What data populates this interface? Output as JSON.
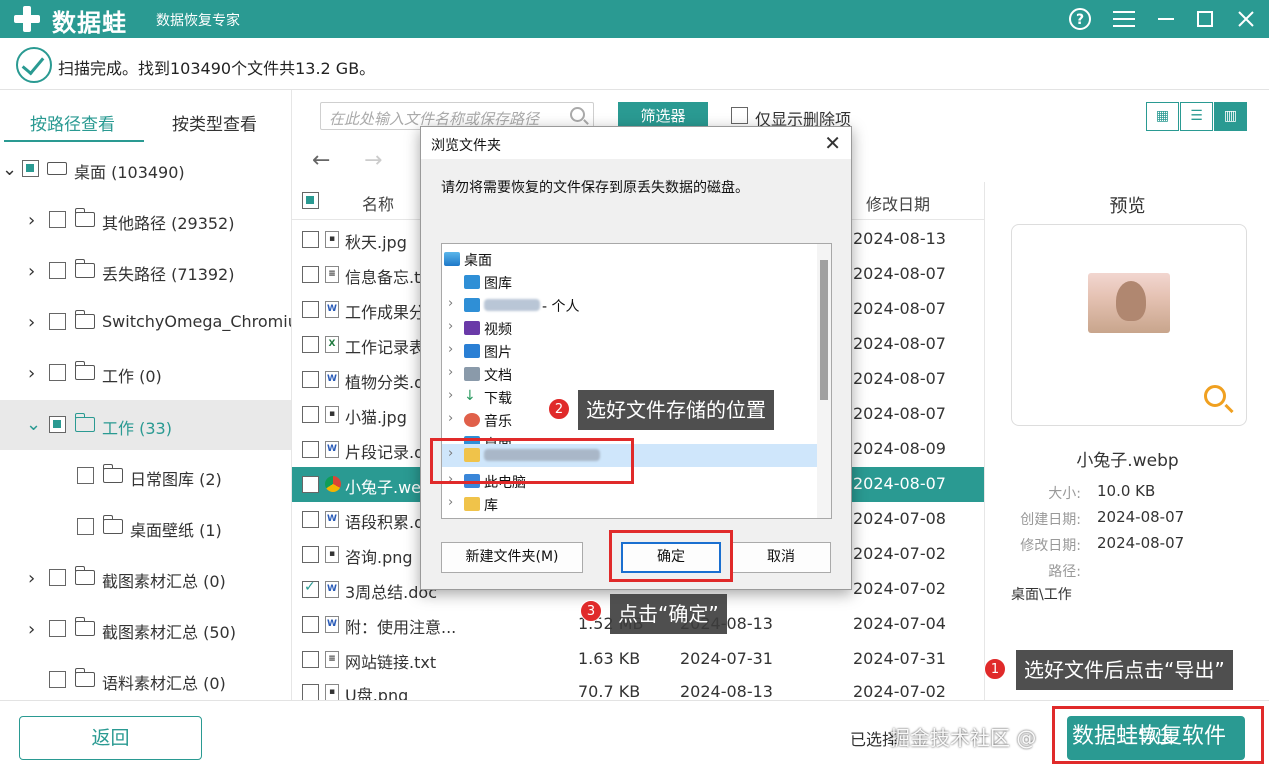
{
  "titlebar": {
    "app_name": "数据蛙",
    "subtitle": "数据恢复专家",
    "help_icon": "question-circle-icon",
    "menu_icon": "hamburger-menu-icon",
    "minimize_icon": "minimize-icon",
    "maximize_icon": "maximize-icon",
    "close_icon": "close-icon"
  },
  "scan": {
    "status": "扫描完成。找到103490个文件共13.2 GB。"
  },
  "left": {
    "tabs": [
      "按路径查看",
      "按类型查看"
    ],
    "tree": [
      {
        "label": "桌面 (103490)"
      },
      {
        "label": "其他路径 (29352)"
      },
      {
        "label": "丢失路径 (71392)"
      },
      {
        "label": "SwitchyOmega_Chromium"
      },
      {
        "label": "工作 (0)"
      },
      {
        "label": "工作 (33)"
      },
      {
        "label": "日常图库 (2)"
      },
      {
        "label": "桌面壁纸 (1)"
      },
      {
        "label": "截图素材汇总 (0)"
      },
      {
        "label": "截图素材汇总 (50)"
      },
      {
        "label": "语料素材汇总 (0)"
      }
    ]
  },
  "toolbar": {
    "search_placeholder": "在此处输入文件名称或保存路径",
    "filter_label": "筛选器",
    "only_deleted_label": "仅显示删除项"
  },
  "list": {
    "header_name": "名称",
    "header_modified": "修改日期",
    "rows": [
      {
        "name": "秋天.jpg",
        "size": "",
        "created": "",
        "modified": "2024-08-13"
      },
      {
        "name": "信息备忘.t",
        "size": "",
        "created": "",
        "modified": "2024-08-07"
      },
      {
        "name": "工作成果分",
        "size": "",
        "created": "",
        "modified": "2024-08-07"
      },
      {
        "name": "工作记录表",
        "size": "",
        "created": "",
        "modified": "2024-08-07"
      },
      {
        "name": "植物分类.d",
        "size": "",
        "created": "",
        "modified": "2024-08-07"
      },
      {
        "name": "小猫.jpg",
        "size": "",
        "created": "",
        "modified": "2024-08-07"
      },
      {
        "name": "片段记录.d",
        "size": "",
        "created": "",
        "modified": "2024-08-09"
      },
      {
        "name": "小兔子.web",
        "size": "",
        "created": "",
        "modified": "2024-08-07"
      },
      {
        "name": "语段积累.d",
        "size": "",
        "created": "",
        "modified": "2024-07-08"
      },
      {
        "name": "咨询.png",
        "size": "",
        "created": "",
        "modified": "2024-07-02"
      },
      {
        "name": "3周总结.doc",
        "size": "",
        "created": "",
        "modified": "2024-07-02"
      },
      {
        "name": "附：使用注意...",
        "size": "1.52 MB",
        "created": "2024-08-13",
        "modified": "2024-07-04"
      },
      {
        "name": "网站链接.txt",
        "size": "1.63 KB",
        "created": "2024-07-31",
        "modified": "2024-07-31"
      },
      {
        "name": "U盘.png",
        "size": "70.7 KB",
        "created": "2024-08-13",
        "modified": "2024-07-02"
      }
    ]
  },
  "preview": {
    "title": "预览",
    "file_name": "小兔子.webp",
    "size_label": "大小:",
    "size_value": "10.0 KB",
    "created_label": "创建日期:",
    "created_value": "2024-08-07",
    "modified_label": "修改日期:",
    "modified_value": "2024-08-07",
    "path_label": "路径:",
    "path_value": "桌面\\工作"
  },
  "bottom": {
    "back_label": "返回",
    "selected_info": "已选择",
    "export_label": "导出"
  },
  "dialog": {
    "title": "浏览文件夹",
    "message": "请勿将需要恢复的文件保存到原丢失数据的磁盘。",
    "tree": [
      {
        "label": "桌面"
      },
      {
        "label": "图库"
      },
      {
        "label": "- 个人"
      },
      {
        "label": "视频"
      },
      {
        "label": "图片"
      },
      {
        "label": "文档"
      },
      {
        "label": "下载"
      },
      {
        "label": "音乐"
      },
      {
        "label": "桌面"
      },
      {
        "label": ""
      },
      {
        "label": "此电脑"
      },
      {
        "label": "库"
      }
    ],
    "new_folder_label": "新建文件夹(M)",
    "ok_label": "确定",
    "cancel_label": "取消"
  },
  "annotations": {
    "step1_num": "1",
    "step1_text": "选好文件后点击“导出”",
    "step2_num": "2",
    "step2_text": "选好文件存储的位置",
    "step3_num": "3",
    "step3_text": "点击“确定”",
    "accent_color": "#e02a2a"
  },
  "watermark": {
    "community": "掘金技术社区 @",
    "brand": "数据蛙恢复软件"
  },
  "colors": {
    "brand": "#2a9a92",
    "annotation": "#e02a2a"
  }
}
